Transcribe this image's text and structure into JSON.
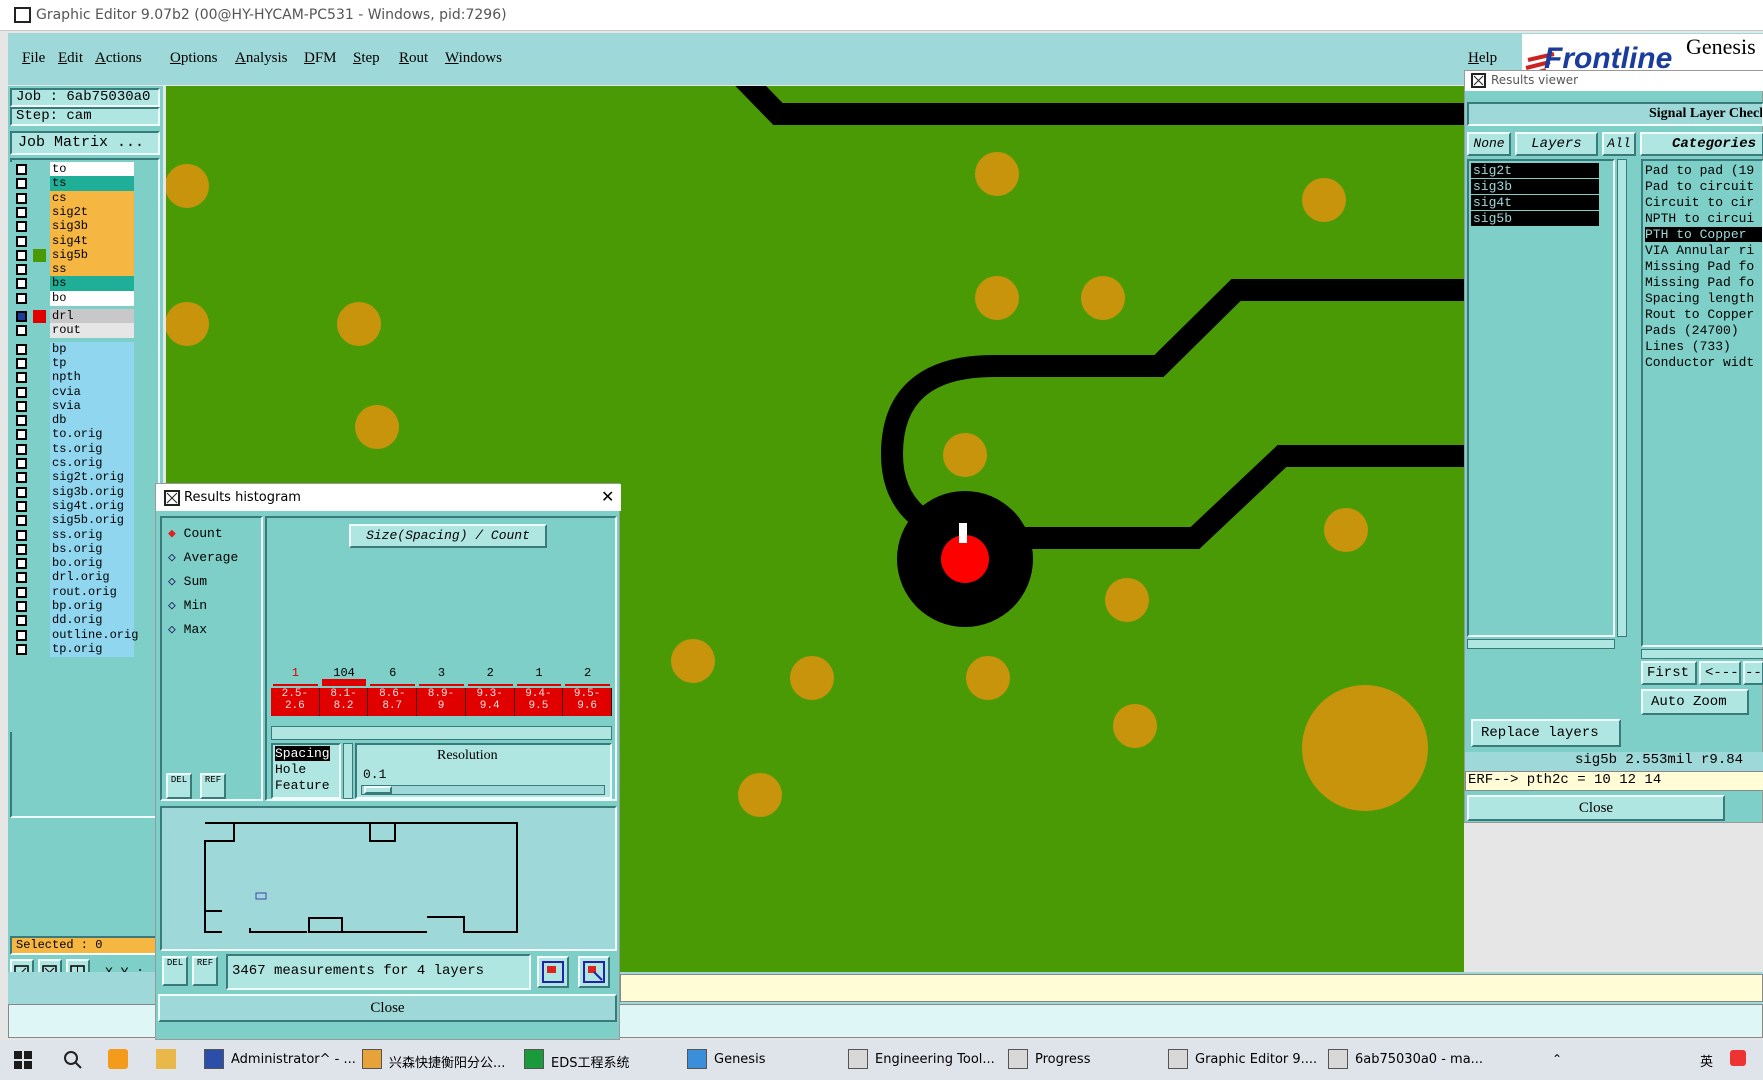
{
  "window": {
    "title": "Graphic Editor 9.07b2 (00@HY-HYCAM-PC531 - Windows, pid:7296)"
  },
  "menu": {
    "items": [
      "File",
      "Edit",
      "Actions",
      "Options",
      "Analysis",
      "DFM",
      "Step",
      "Rout",
      "Windows"
    ],
    "help": "Help"
  },
  "logo": {
    "brand": "Frontline",
    "product": "Genesis"
  },
  "left": {
    "job_label": "Job : 6ab75030a0",
    "step_label": "Step: cam",
    "job_matrix": "Job Matrix ...",
    "selected": "Selected : 0",
    "xy": "X Y :"
  },
  "layers": [
    {
      "name": "to",
      "color": "#ffffff"
    },
    {
      "name": "ts",
      "color": "#1fae98"
    },
    {
      "name": "cs",
      "color": "#f5b642"
    },
    {
      "name": "sig2t",
      "color": "#f5b642"
    },
    {
      "name": "sig3b",
      "color": "#f5b642"
    },
    {
      "name": "sig4t",
      "color": "#f5b642"
    },
    {
      "name": "sig5b",
      "color": "#f5b642",
      "active": true
    },
    {
      "name": "ss",
      "color": "#f5b642"
    },
    {
      "name": "bs",
      "color": "#1fae98"
    },
    {
      "name": "bo",
      "color": "#ffffff"
    },
    {
      "name": "drl",
      "color": "#c8c8c8",
      "red": true
    },
    {
      "name": "rout",
      "color": "#e6e6e6"
    },
    {
      "name": "bp",
      "color": "#8fd6ee"
    },
    {
      "name": "tp",
      "color": "#8fd6ee"
    },
    {
      "name": "npth",
      "color": "#8fd6ee"
    },
    {
      "name": "cvia",
      "color": "#8fd6ee"
    },
    {
      "name": "svia",
      "color": "#8fd6ee"
    },
    {
      "name": "db",
      "color": "#8fd6ee"
    },
    {
      "name": "to.orig",
      "color": "#8fd6ee"
    },
    {
      "name": "ts.orig",
      "color": "#8fd6ee"
    },
    {
      "name": "cs.orig",
      "color": "#8fd6ee"
    },
    {
      "name": "sig2t.orig",
      "color": "#8fd6ee"
    },
    {
      "name": "sig3b.orig",
      "color": "#8fd6ee"
    },
    {
      "name": "sig4t.orig",
      "color": "#8fd6ee"
    },
    {
      "name": "sig5b.orig",
      "color": "#8fd6ee"
    },
    {
      "name": "ss.orig",
      "color": "#8fd6ee"
    },
    {
      "name": "bs.orig",
      "color": "#8fd6ee"
    },
    {
      "name": "bo.orig",
      "color": "#8fd6ee"
    },
    {
      "name": "drl.orig",
      "color": "#8fd6ee"
    },
    {
      "name": "rout.orig",
      "color": "#8fd6ee"
    },
    {
      "name": "bp.orig",
      "color": "#8fd6ee"
    },
    {
      "name": "dd.orig",
      "color": "#8fd6ee"
    },
    {
      "name": "outline.orig",
      "color": "#8fd6ee"
    },
    {
      "name": "tp.orig",
      "color": "#8fd6ee"
    }
  ],
  "histogram": {
    "window_title": "Results histogram",
    "close_glyph": "✕",
    "modes": [
      "Count",
      "Average",
      "Sum",
      "Min",
      "Max"
    ],
    "selected_mode": "Count",
    "chart_title": "Size(Spacing) / Count",
    "counts": [
      "1",
      "104",
      "6",
      "3",
      "2",
      "1",
      "2"
    ],
    "bins": [
      "2.5-\n2.6",
      "8.1-\n8.2",
      "8.6-\n8.7",
      "8.9-\n9",
      "9.3-\n9.4",
      "9.4-\n9.5",
      "9.5-\n9.6"
    ],
    "kinds": [
      "Spacing",
      "Hole",
      "Feature"
    ],
    "resolution_label": "Resolution",
    "resolution_value": "0.1",
    "summary": "3467 measurements for 4 layers",
    "close_button": "Close",
    "del": "DEL",
    "ref": "REF"
  },
  "results": {
    "window_title": "Results viewer",
    "check_name": "Signal Layer Check",
    "none_btn": "None",
    "layers_btn": "Layers",
    "all_btn": "All",
    "categories_btn": "Categories",
    "layers": [
      "sig2t",
      "sig3b",
      "sig4t",
      "sig5b"
    ],
    "categories": [
      "Pad to pad (19",
      "Pad to circuit",
      "Circuit to cir",
      "NPTH to circui",
      "PTH to Copper",
      "VIA Annular ri",
      "Missing Pad fo",
      "Missing Pad fo",
      "Spacing length",
      "Rout to Copper",
      "Pads (24700)",
      "Lines (733)",
      "Conductor widt"
    ],
    "replace_layers": "Replace layers",
    "first_btn": "First",
    "prev_btn": "<---",
    "next_btn": "--",
    "auto_zoom": "Auto Zoom",
    "status": "sig5b 2.553mil r9.84",
    "erf": "ERF--> pth2c = 10 12 14",
    "close": "Close"
  },
  "taskbar": {
    "items": [
      "Administrator^ - ...",
      "兴森快捷衡阳分公...",
      "EDS工程系统",
      "Genesis",
      "Engineering Tool...",
      "Progress",
      "Graphic Editor 9....",
      "6ab75030a0 - ma..."
    ],
    "lang": "英"
  }
}
